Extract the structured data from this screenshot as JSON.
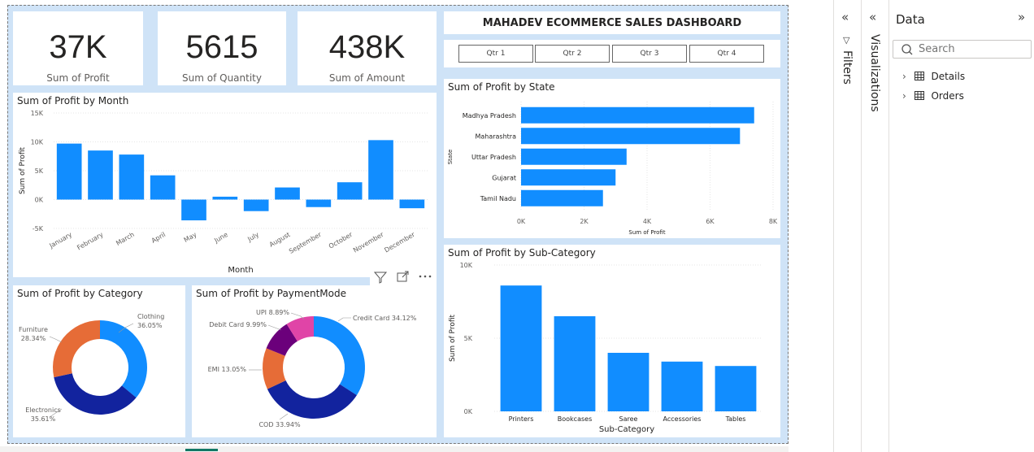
{
  "kpis": [
    {
      "value": "37K",
      "label": "Sum of Profit"
    },
    {
      "value": "5615",
      "label": "Sum of Quantity"
    },
    {
      "value": "438K",
      "label": "Sum of Amount"
    }
  ],
  "dashboard_title": "MAHADEV ECOMMERCE SALES DASHBOARD",
  "slicer": [
    "Qtr 1",
    "Qtr 2",
    "Qtr 3",
    "Qtr 4"
  ],
  "visual_header_icons": [
    "filter-icon",
    "focus-mode-icon",
    "more-options-icon"
  ],
  "right_panes": {
    "filters_label": "Filters",
    "visualizations_label": "Visualizations",
    "data_title": "Data",
    "search_placeholder": "Search",
    "tables": [
      "Details",
      "Orders"
    ]
  },
  "colors": {
    "bar": "#118dff",
    "canvas": "#cfe3f7",
    "orange": "#e66c37",
    "navy": "#12239e",
    "purple": "#6b007b",
    "pink": "#e044a7"
  },
  "chart_data": [
    {
      "type": "bar",
      "title": "Sum of Profit by Month",
      "xlabel": "Month",
      "ylabel": "Sum of Profit",
      "categories": [
        "January",
        "February",
        "March",
        "April",
        "May",
        "June",
        "July",
        "August",
        "September",
        "October",
        "November",
        "December"
      ],
      "values": [
        9700,
        8500,
        7800,
        4200,
        -3600,
        500,
        -2000,
        2100,
        -1300,
        3000,
        10300,
        -1500
      ],
      "ylim": [
        -5000,
        15000
      ],
      "yticks": [
        -5000,
        0,
        5000,
        10000,
        15000
      ],
      "yticklabels": [
        "-5K",
        "0K",
        "5K",
        "10K",
        "15K"
      ]
    },
    {
      "type": "bar",
      "orientation": "horizontal",
      "title": "Sum of Profit by State",
      "xlabel": "Sum of Profit",
      "ylabel": "State",
      "categories": [
        "Madhya Pradesh",
        "Maharashtra",
        "Uttar Pradesh",
        "Gujarat",
        "Tamil Nadu"
      ],
      "values": [
        7400,
        6950,
        3350,
        3000,
        2600
      ],
      "xlim": [
        0,
        8000
      ],
      "xticks": [
        0,
        2000,
        4000,
        6000,
        8000
      ],
      "xticklabels": [
        "0K",
        "2K",
        "4K",
        "6K",
        "8K"
      ]
    },
    {
      "type": "bar",
      "title": "Sum of Profit by Sub-Category",
      "xlabel": "Sub-Category",
      "ylabel": "Sum of Profit",
      "categories": [
        "Printers",
        "Bookcases",
        "Saree",
        "Accessories",
        "Tables"
      ],
      "values": [
        8600,
        6500,
        4000,
        3400,
        3100
      ],
      "ylim": [
        0,
        10000
      ],
      "yticks": [
        0,
        5000,
        10000
      ],
      "yticklabels": [
        "0K",
        "5K",
        "10K"
      ]
    },
    {
      "type": "pie",
      "variant": "donut",
      "title": "Sum of Profit by Category",
      "labels": [
        "Clothing",
        "Electronics",
        "Furniture"
      ],
      "label_lines": [
        [
          "Clothing",
          "36.05%"
        ],
        [
          "Electronics",
          "35.61%"
        ],
        [
          "Furniture",
          "28.34%"
        ]
      ],
      "values": [
        36.05,
        35.61,
        28.34
      ],
      "colors": [
        "#118dff",
        "#12239e",
        "#e66c37"
      ]
    },
    {
      "type": "pie",
      "variant": "donut",
      "title": "Sum of Profit by PaymentMode",
      "labels": [
        "Credit Card",
        "COD",
        "EMI",
        "Debit Card",
        "UPI"
      ],
      "label_texts": [
        "Credit Card 34.12%",
        "COD 33.94%",
        "EMI 13.05%",
        "Debit Card 9.99%",
        "UPI 8.89%"
      ],
      "values": [
        34.12,
        33.94,
        13.05,
        9.99,
        8.89
      ],
      "colors": [
        "#118dff",
        "#12239e",
        "#e66c37",
        "#6b007b",
        "#e044a7"
      ]
    }
  ]
}
